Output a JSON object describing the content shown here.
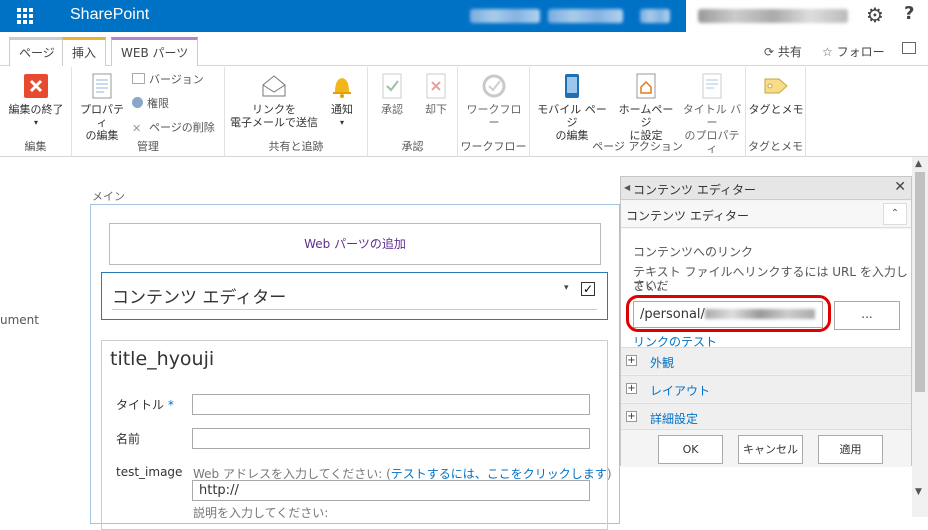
{
  "suitebar": {
    "brand": "SharePoint"
  },
  "tabs": {
    "page": "ページ",
    "insert": "挿入",
    "webparts": "WEB パーツ"
  },
  "actions": {
    "share": "共有",
    "follow": "フォロー"
  },
  "ribbon": {
    "edit": {
      "stop_editing": "編集の終了",
      "group": "編集"
    },
    "manage": {
      "properties_line1": "プロパティ",
      "properties_line2": "の編集",
      "versions": "バージョン",
      "permissions": "権限",
      "delete_page": "ページの削除",
      "group": "管理"
    },
    "share": {
      "email_line1": "リンクを",
      "email_line2": "電子メールで送信",
      "alert": "通知",
      "group": "共有と追跡"
    },
    "approval": {
      "approve": "承認",
      "reject": "却下",
      "group": "承認"
    },
    "workflow": {
      "workflow": "ワークフロー",
      "group": "ワークフロー"
    },
    "page_actions": {
      "mobile_line1": "モバイル ページ",
      "mobile_line2": "の編集",
      "homepage_line1": "ホームページ",
      "homepage_line2": "に設定",
      "titlebar_line1": "タイトル バー",
      "titlebar_line2": "のプロパティ",
      "group": "ページ アクション"
    },
    "tags": {
      "tags_notes": "タグとメモ",
      "group": "タグとメモ"
    }
  },
  "page": {
    "left_fragment": "ument",
    "zone_label": "メイン",
    "add_webpart": "Web パーツの追加",
    "cewp_title": "コンテンツ エディター",
    "form_title": "title_hyouji",
    "fields": {
      "title_label": "タイトル",
      "required_mark": "*",
      "name_label": "名前",
      "image_label": "test_image",
      "url_hint": "Web アドレスを入力してください: (",
      "url_hint_link": "テストするには、ここをクリックします",
      "url_hint_end": ")",
      "url_value": "http://",
      "desc_hint": "説明を入力してください:"
    }
  },
  "toolpane": {
    "header": "コンテンツ エディター",
    "section": "コンテンツ エディター",
    "link_label": "コンテンツへのリンク",
    "link_help_1": "テキスト ファイルへリンクするには URL を入力してくだ",
    "link_help_2": "さい。",
    "link_value": "/personal/",
    "browse": "...",
    "test_link": "リンクのテスト",
    "appearance": "外観",
    "layout": "レイアウト",
    "advanced": "詳細設定",
    "ok": "OK",
    "cancel": "キャンセル",
    "apply": "適用"
  },
  "colors": {
    "suitebar": "#0072c6",
    "link": "#0072c6",
    "highlight": "#e00000"
  }
}
